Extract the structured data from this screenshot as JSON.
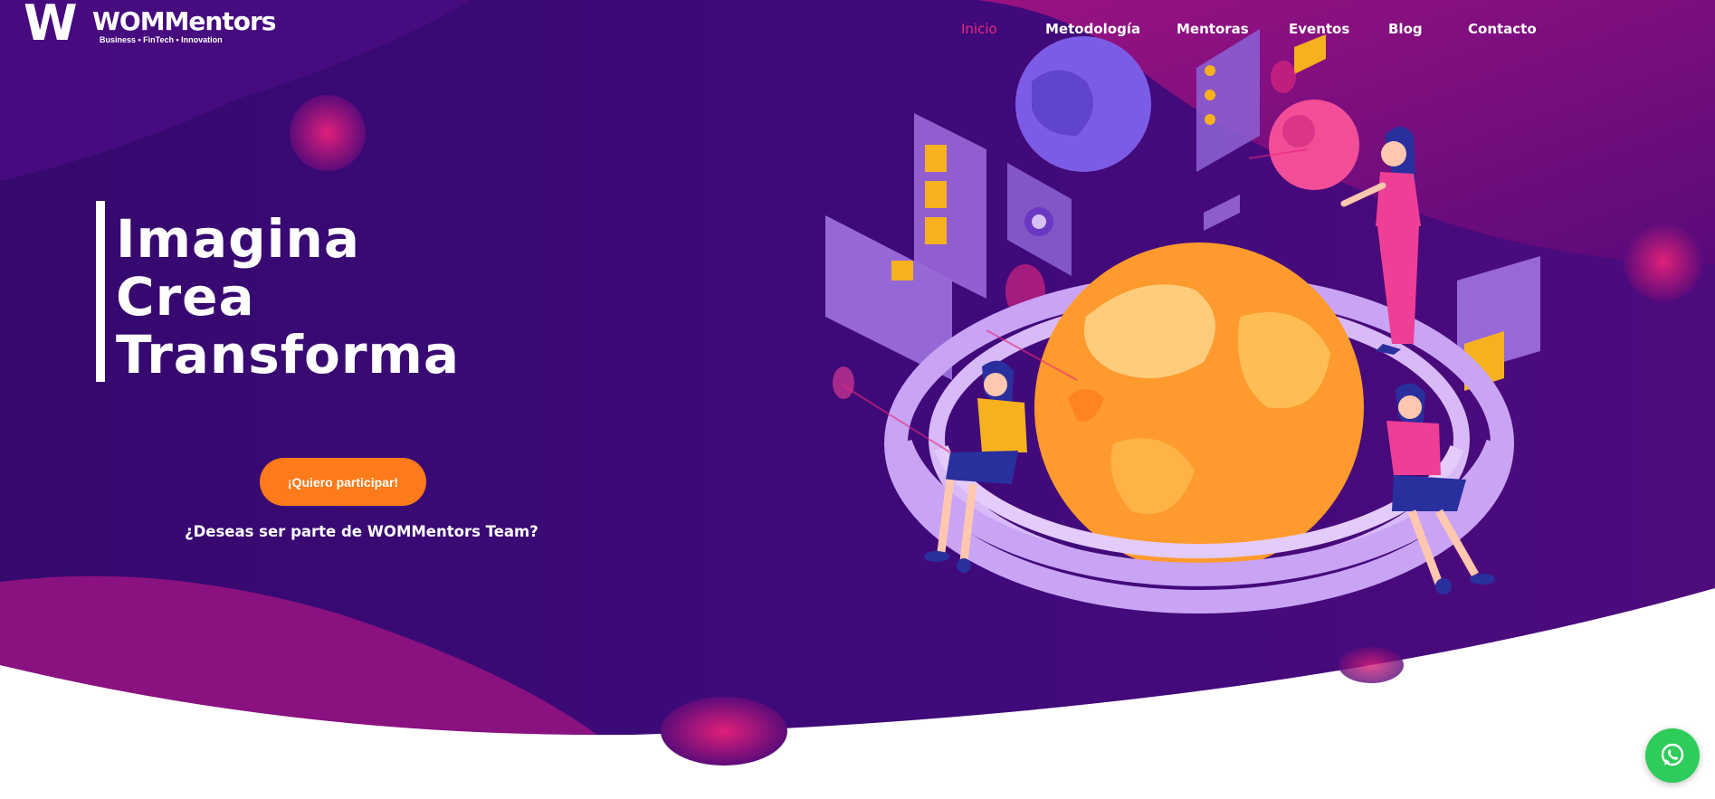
{
  "brand": {
    "logo_mark": "W",
    "name": "WOMMentors",
    "tagline": "Business • FinTech • Innovation"
  },
  "nav": {
    "items": [
      {
        "label": "Inicio",
        "active": true
      },
      {
        "label": "Metodología",
        "active": false
      },
      {
        "label": "Mentoras",
        "active": false
      },
      {
        "label": "Eventos",
        "active": false
      },
      {
        "label": "Blog",
        "active": false
      },
      {
        "label": "Contacto",
        "active": false
      }
    ]
  },
  "hero": {
    "headline_lines": [
      "Imagina",
      "Crea",
      "Transforma"
    ],
    "cta_label": "¡Quiero participar!",
    "cta_subtext": "¿Deseas ser parte de WOMMentors Team?"
  },
  "floating": {
    "whatsapp_icon": "whatsapp-icon"
  },
  "colors": {
    "hero_background": "#3a0a78",
    "accent_pink": "#e8287e",
    "cta_orange": "#ff7a1a",
    "whatsapp_green": "#2ecc5a",
    "text": "#ffffff"
  }
}
